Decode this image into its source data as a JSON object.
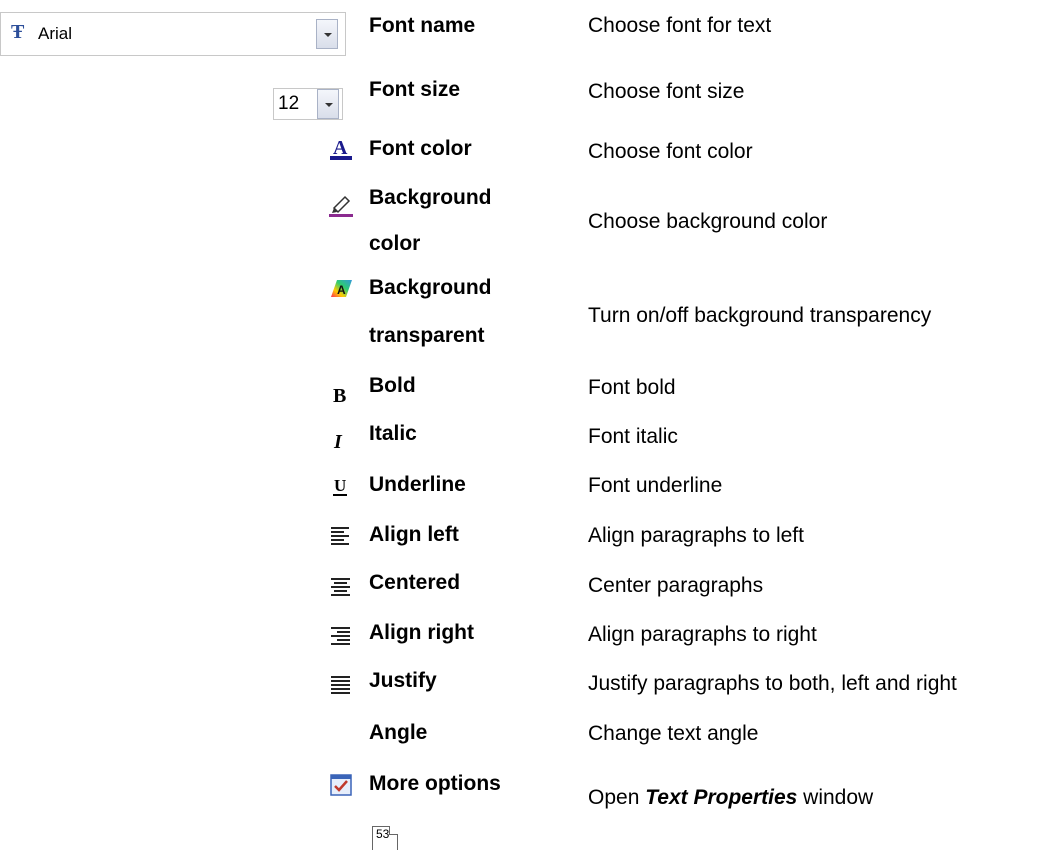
{
  "font_combo": {
    "value": "Arial"
  },
  "size_combo": {
    "value": "12"
  },
  "items": [
    {
      "name": "Font name",
      "desc": "Choose font for text"
    },
    {
      "name": "Font size",
      "desc": "Choose font size"
    },
    {
      "name": "Font color",
      "desc": "Choose font color"
    },
    {
      "name_line1": "Background",
      "name_line2": "color",
      "desc": "Choose background color"
    },
    {
      "name_line1": "Background",
      "name_line2": "transparent",
      "desc": "Turn on/off background transparency"
    },
    {
      "name": "Bold",
      "desc": "Font bold"
    },
    {
      "name": "Italic",
      "desc": "Font italic"
    },
    {
      "name": "Underline",
      "desc": "Font underline"
    },
    {
      "name": "Align left",
      "desc": "Align paragraphs to left"
    },
    {
      "name": "Centered",
      "desc": "Center paragraphs"
    },
    {
      "name": "Align right",
      "desc": "Align paragraphs to right"
    },
    {
      "name": "Justify",
      "desc": "Justify paragraphs to both, left and right"
    },
    {
      "name": "Angle",
      "desc": "Change text angle"
    },
    {
      "name": "More options",
      "desc_prefix": "Open ",
      "desc_emph": "Text Properties",
      "desc_suffix": " window"
    }
  ],
  "page_number": "53",
  "icons": [
    "truetype-font-icon",
    "font-color-icon",
    "background-color-icon",
    "background-transparent-icon",
    "bold-icon",
    "italic-icon",
    "underline-icon",
    "align-left-icon",
    "align-center-icon",
    "align-right-icon",
    "justify-icon",
    "more-options-icon"
  ],
  "colors": {
    "font_color_bar": "#1a1a8c",
    "background_color_bar": "#8b2a8f",
    "more_options_check": "#c0392b"
  }
}
